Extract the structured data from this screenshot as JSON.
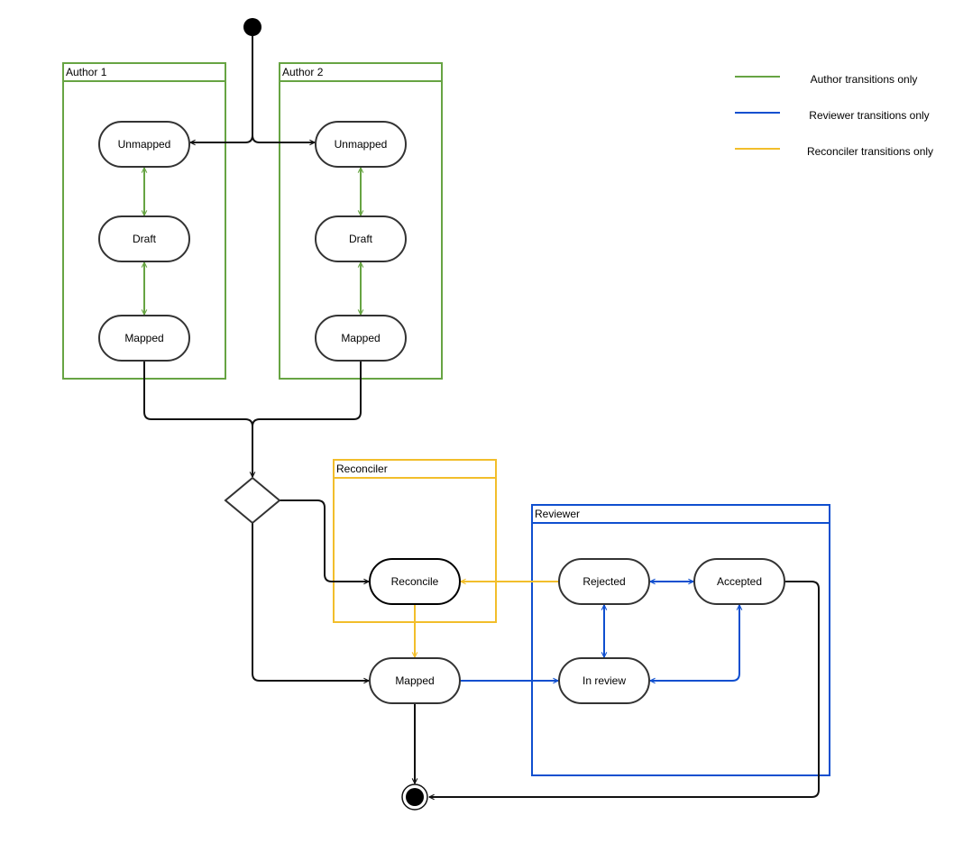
{
  "lanes": {
    "author1": {
      "title": "Author 1",
      "color": "#67a443"
    },
    "author2": {
      "title": "Author 2",
      "color": "#67a443"
    },
    "reconciler": {
      "title": "Reconciler",
      "color": "#f2be2b"
    },
    "reviewer": {
      "title": "Reviewer",
      "color": "#0f4fcf"
    }
  },
  "nodes": {
    "a1_unmapped": "Unmapped",
    "a1_draft": "Draft",
    "a1_mapped": "Mapped",
    "a2_unmapped": "Unmapped",
    "a2_draft": "Draft",
    "a2_mapped": "Mapped",
    "reconcile": "Reconcile",
    "mapped": "Mapped",
    "rejected": "Rejected",
    "accepted": "Accepted",
    "in_review": "In review"
  },
  "legend": [
    {
      "label": "Author transitions only",
      "color": "#67a443"
    },
    {
      "label": "Reviewer transitions only",
      "color": "#0f4fcf"
    },
    {
      "label": "Reconciler transitions only",
      "color": "#f2be2b"
    }
  ]
}
